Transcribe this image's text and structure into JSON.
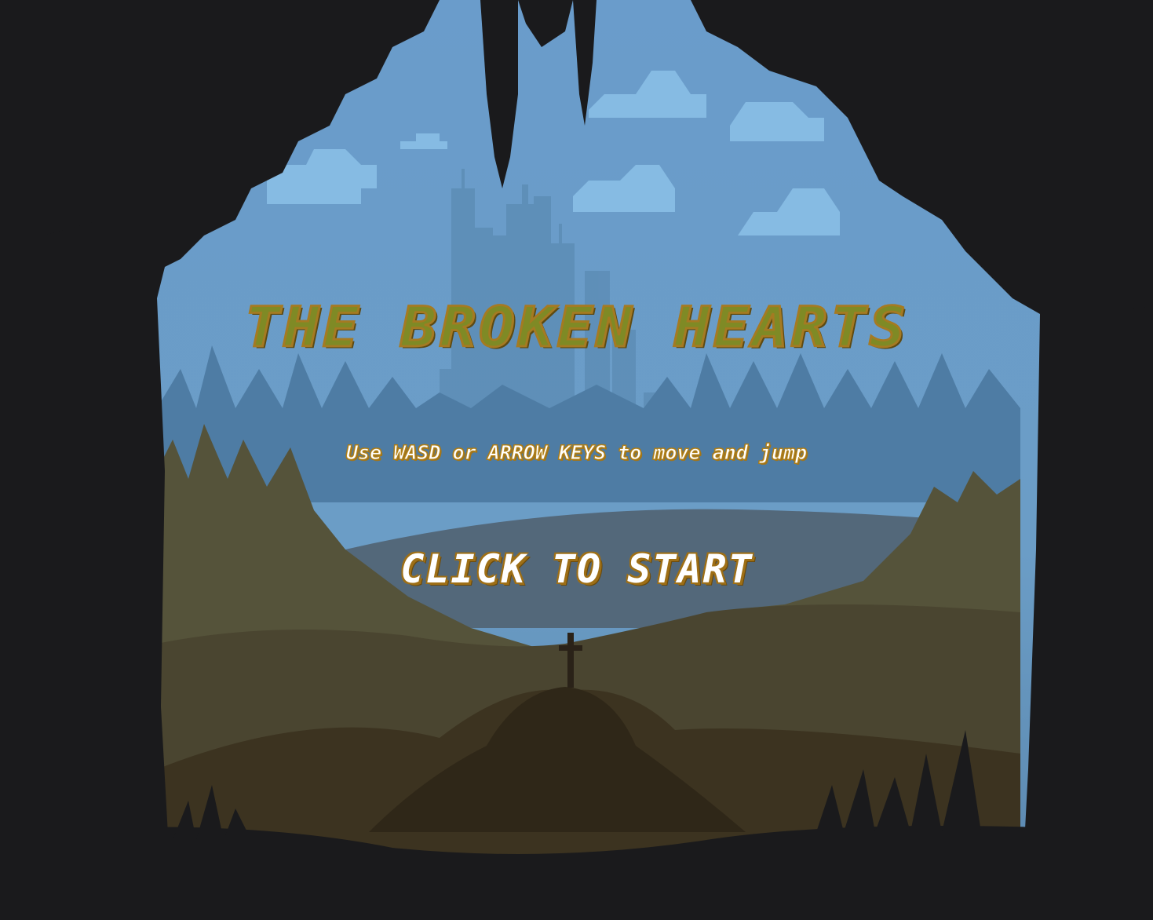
{
  "game": {
    "title": "THE BROKEN HEARTS",
    "instructions": "Use WASD or ARROW KEYS to move and jump",
    "start_label": "CLICK TO START"
  },
  "colors": {
    "sky": "#6ea1cb",
    "sky_light": "#82b4de",
    "cloud": "#8cc0e6",
    "city": "#5f8fb8",
    "forest_far": "#4f7ea6",
    "hill_mid": "#56533a",
    "hill_near": "#3d3522",
    "ground": "#2e2718",
    "silhouette": "#1a1a1c",
    "title_fill": "#7f8a25",
    "title_outline": "#a57a22"
  }
}
